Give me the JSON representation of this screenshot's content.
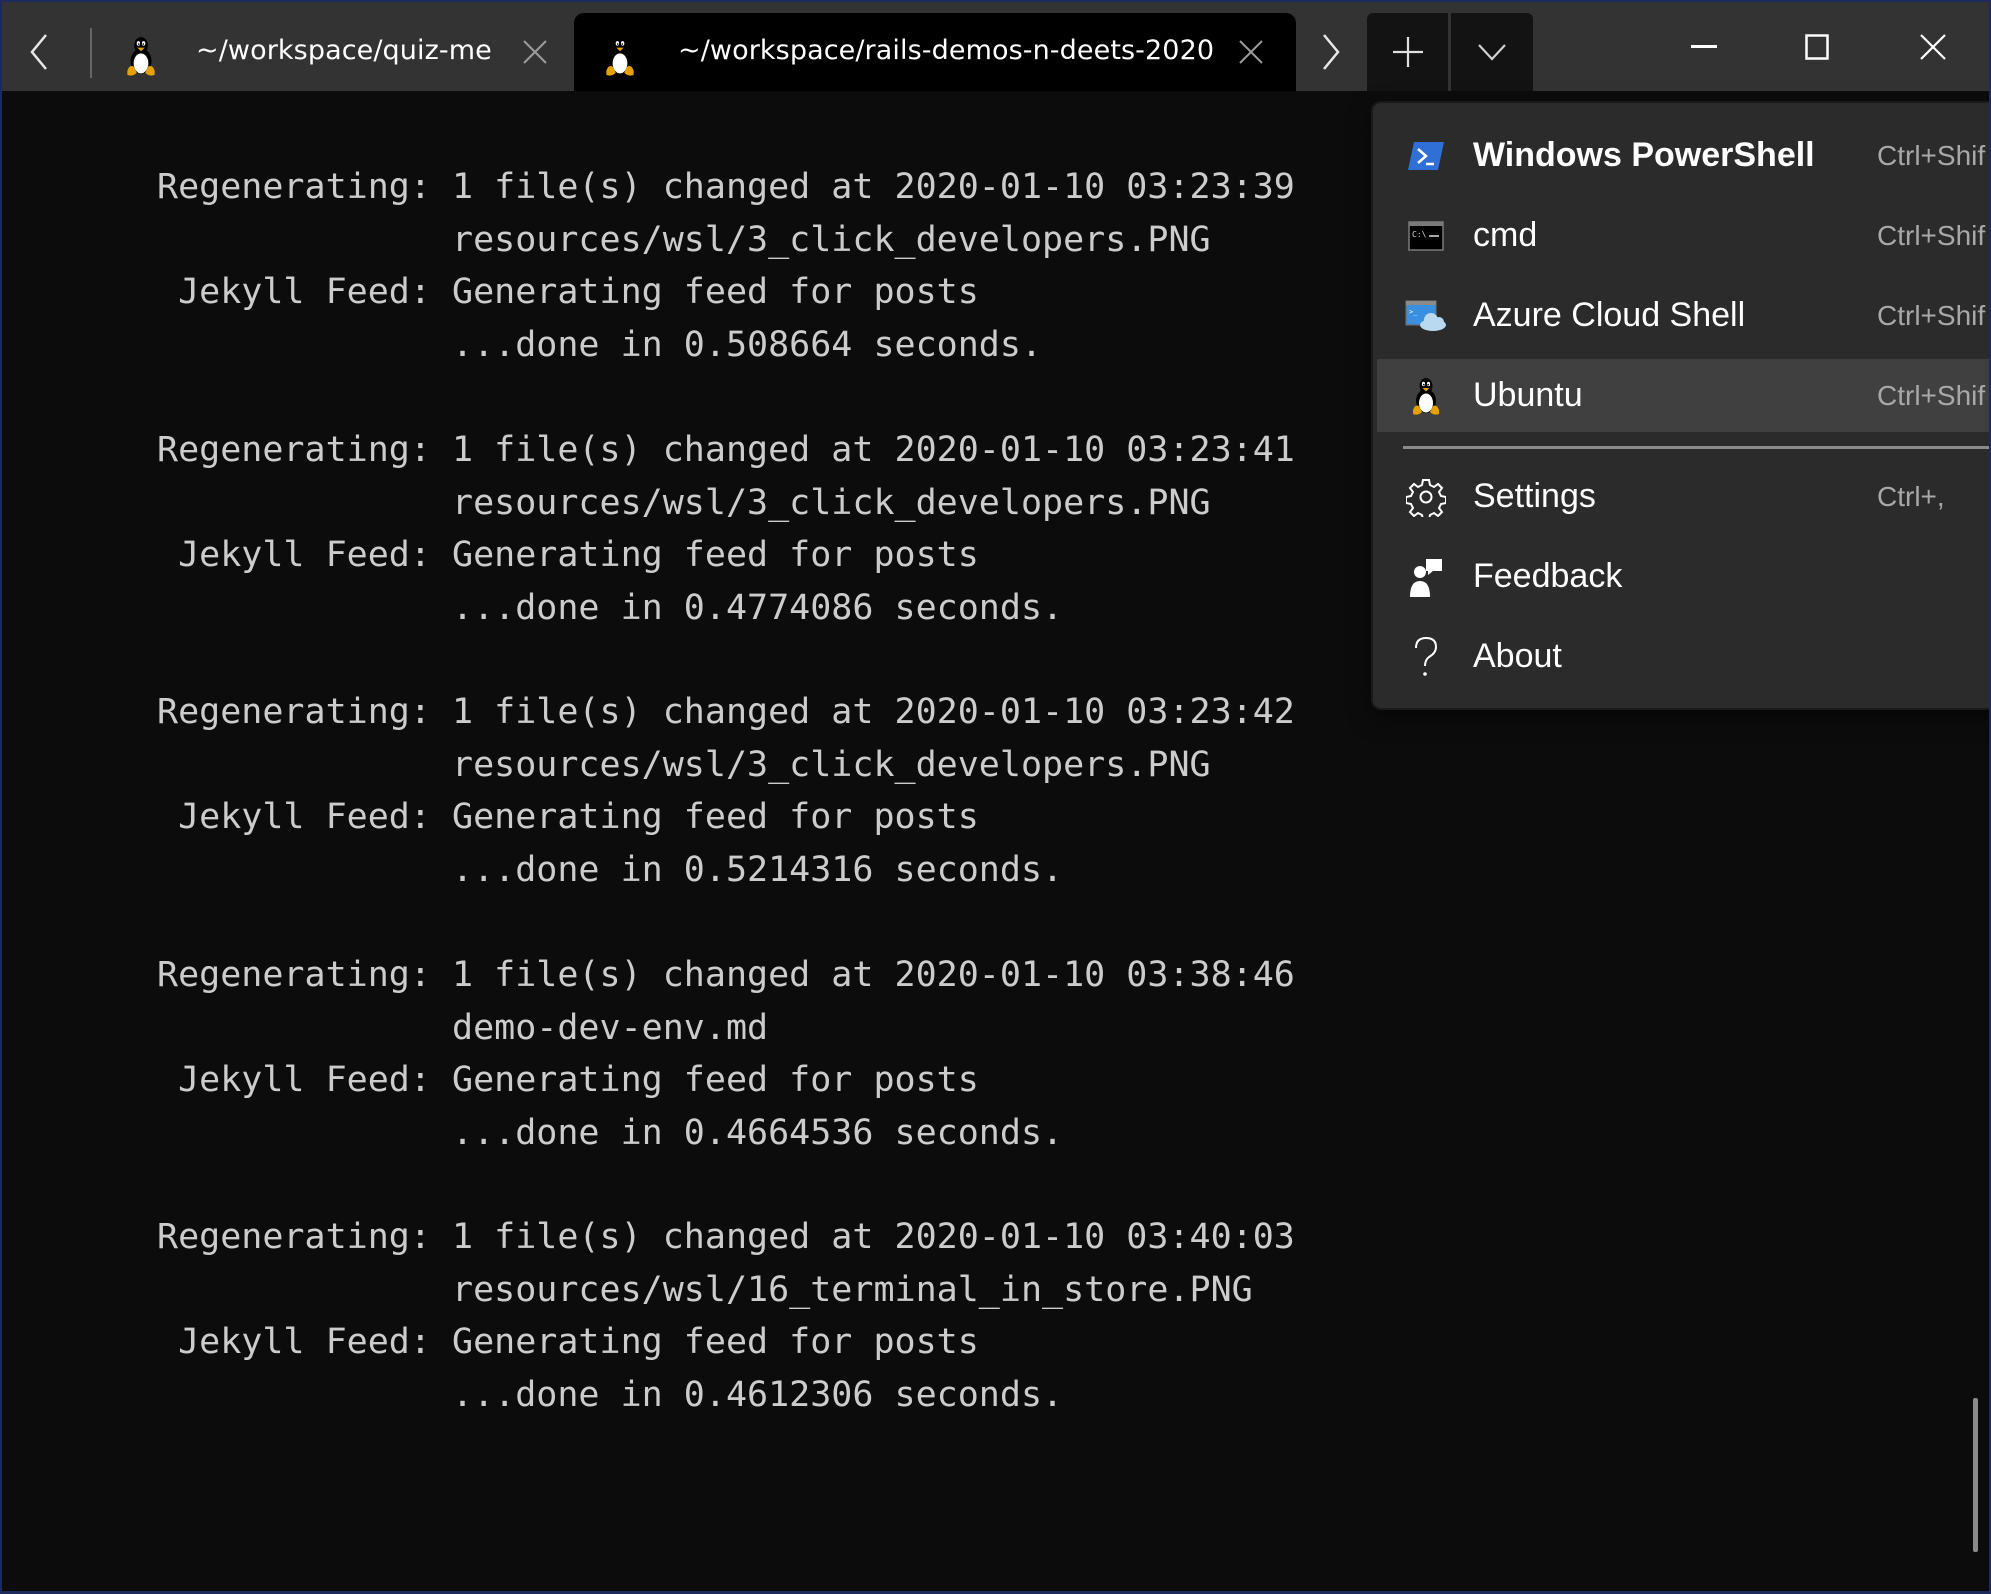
{
  "titlebar": {
    "tabs": [
      {
        "title": "~/workspace/quiz-me",
        "icon": "tux-icon",
        "active": false
      },
      {
        "title": "~/workspace/rails-demos-n-deets-2020",
        "icon": "tux-icon",
        "active": true
      }
    ],
    "buttons": {
      "scroll_left": "chevron-left-icon",
      "scroll_right": "chevron-right-icon",
      "new_tab": "plus-icon",
      "dropdown": "chevron-down-icon",
      "minimize": "minimize-icon",
      "maximize": "maximize-icon",
      "close": "close-icon"
    }
  },
  "terminal": {
    "blocks": [
      {
        "lines": [
          "Regenerating: 1 file(s) changed at 2020-01-10 03:23:39",
          "              resources/wsl/3_click_developers.PNG",
          " Jekyll Feed: Generating feed for posts",
          "              ...done in 0.508664 seconds."
        ]
      },
      {
        "lines": [
          "Regenerating: 1 file(s) changed at 2020-01-10 03:23:41",
          "              resources/wsl/3_click_developers.PNG",
          " Jekyll Feed: Generating feed for posts",
          "              ...done in 0.4774086 seconds."
        ]
      },
      {
        "lines": [
          "Regenerating: 1 file(s) changed at 2020-01-10 03:23:42",
          "              resources/wsl/3_click_developers.PNG",
          " Jekyll Feed: Generating feed for posts",
          "              ...done in 0.5214316 seconds."
        ]
      },
      {
        "lines": [
          "Regenerating: 1 file(s) changed at 2020-01-10 03:38:46",
          "              demo-dev-env.md",
          " Jekyll Feed: Generating feed for posts",
          "              ...done in 0.4664536 seconds."
        ]
      },
      {
        "lines": [
          "Regenerating: 1 file(s) changed at 2020-01-10 03:40:03",
          "              resources/wsl/16_terminal_in_store.PNG",
          " Jekyll Feed: Generating feed for posts",
          "              ...done in 0.4612306 seconds."
        ]
      }
    ]
  },
  "menu": {
    "profiles": [
      {
        "label": "Windows PowerShell",
        "shortcut": "Ctrl+Shif",
        "icon": "powershell-icon",
        "bold": true,
        "hover": false
      },
      {
        "label": "cmd",
        "shortcut": "Ctrl+Shif",
        "icon": "cmd-icon",
        "bold": false,
        "hover": false
      },
      {
        "label": "Azure Cloud Shell",
        "shortcut": "Ctrl+Shif",
        "icon": "azure-cloud-shell-icon",
        "bold": false,
        "hover": false
      },
      {
        "label": "Ubuntu",
        "shortcut": "Ctrl+Shif",
        "icon": "tux-icon",
        "bold": false,
        "hover": true
      }
    ],
    "actions": [
      {
        "label": "Settings",
        "shortcut": "Ctrl+,",
        "icon": "gear-icon"
      },
      {
        "label": "Feedback",
        "shortcut": "",
        "icon": "feedback-icon"
      },
      {
        "label": "About",
        "shortcut": "",
        "icon": "question-icon"
      }
    ]
  },
  "colors": {
    "titlebar_bg": "#333333",
    "active_tab_bg": "#000000",
    "terminal_bg": "#0c0c0c",
    "terminal_fg": "#cccccc",
    "menu_bg": "#2b2b2b",
    "menu_hover_bg": "#404040",
    "window_border": "#1f2a5c",
    "powershell_blue": "#2f6fd6"
  }
}
